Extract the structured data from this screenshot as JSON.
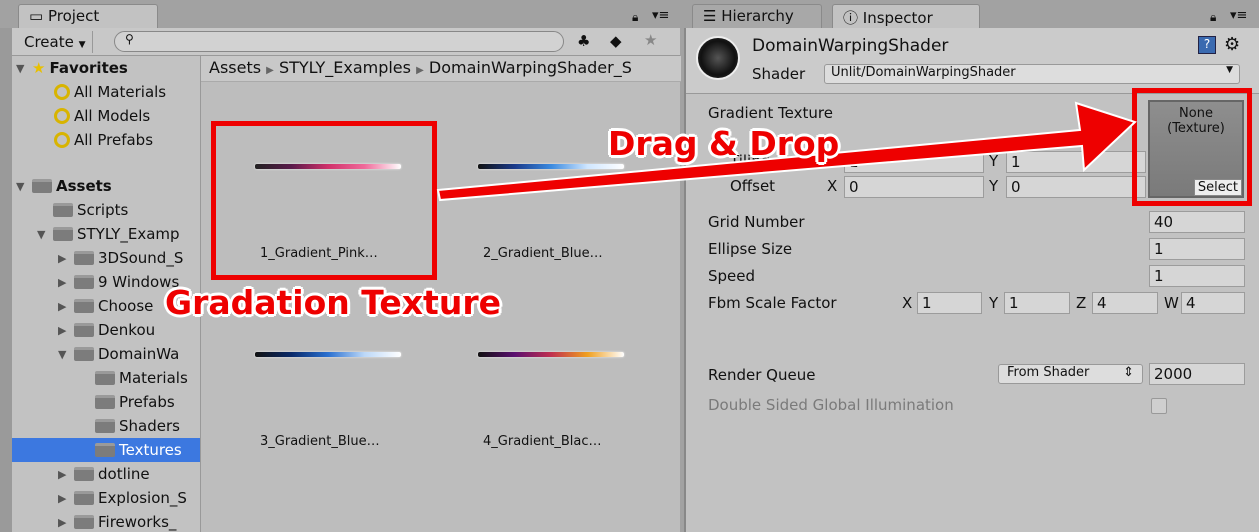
{
  "project": {
    "tab": "Project",
    "create": "Create",
    "search_placeholder": "",
    "breadcrumb": [
      "Assets",
      "STYLY_Examples",
      "DomainWarpingShader_S"
    ],
    "favorites": {
      "label": "Favorites",
      "items": [
        "All Materials",
        "All Models",
        "All Prefabs"
      ]
    },
    "assets": {
      "label": "Assets",
      "items": [
        {
          "label": "Scripts",
          "depth": 1,
          "expand": ""
        },
        {
          "label": "STYLY_Examp",
          "depth": 1,
          "expand": "open"
        },
        {
          "label": "3DSound_S",
          "depth": 2,
          "expand": "closed"
        },
        {
          "label": "9 Windows",
          "depth": 2,
          "expand": "closed"
        },
        {
          "label": "Choose",
          "depth": 2,
          "expand": "closed"
        },
        {
          "label": "Denkou",
          "depth": 2,
          "expand": "closed"
        },
        {
          "label": "DomainWa",
          "depth": 2,
          "expand": "open"
        },
        {
          "label": "Materials",
          "depth": 3,
          "expand": ""
        },
        {
          "label": "Prefabs",
          "depth": 3,
          "expand": ""
        },
        {
          "label": "Shaders",
          "depth": 3,
          "expand": ""
        },
        {
          "label": "Textures",
          "depth": 3,
          "expand": "",
          "selected": true
        },
        {
          "label": "dotline",
          "depth": 2,
          "expand": "closed"
        },
        {
          "label": "Explosion_S",
          "depth": 2,
          "expand": "closed"
        },
        {
          "label": "Fireworks_",
          "depth": 2,
          "expand": "closed"
        }
      ]
    },
    "grid": [
      {
        "label": "1_Gradient_Pink…",
        "gradient": "linear-gradient(90deg,#222,#5a1a4a,#d0306a,#f06a9a,#fff)"
      },
      {
        "label": "2_Gradient_Blue…",
        "gradient": "linear-gradient(90deg,#111,#1a3a8a,#3a8ae0,#cfe6ff,#fff)"
      },
      {
        "label": "3_Gradient_Blue…",
        "gradient": "linear-gradient(90deg,#111,#0a2a6a,#2a70d0,#bcd8f8,#fff)"
      },
      {
        "label": "4_Gradient_Blac…",
        "gradient": "linear-gradient(90deg,#111,#5a1070,#c03050,#f0a020,#fff)"
      }
    ]
  },
  "hierarchy": {
    "tab": "Hierarchy"
  },
  "inspector": {
    "tab": "Inspector",
    "name": "DomainWarpingShader",
    "shader_label": "Shader",
    "shader_value": "Unlit/DomainWarpingShader",
    "gradient_texture": "Gradient Texture",
    "tiling": "Tiling",
    "tiling_x": "1",
    "tiling_y": "1",
    "offset": "Offset",
    "offset_x": "0",
    "offset_y": "0",
    "texture_none": "None\n(Texture)",
    "select": "Select",
    "grid_number": "Grid Number",
    "grid_number_value": "40",
    "ellipse_size": "Ellipse Size",
    "ellipse_size_value": "1",
    "speed": "Speed",
    "speed_value": "1",
    "fbm": "Fbm Scale Factor",
    "fbm_x": "1",
    "fbm_y": "1",
    "fbm_z": "4",
    "fbm_w": "4",
    "render_queue": "Render Queue",
    "render_queue_mode": "From Shader",
    "render_queue_value": "2000",
    "dsgi": "Double Sided Global Illumination"
  },
  "annotations": {
    "gradation": "Gradation Texture",
    "drag": "Drag & Drop",
    "color": "#e00000"
  }
}
